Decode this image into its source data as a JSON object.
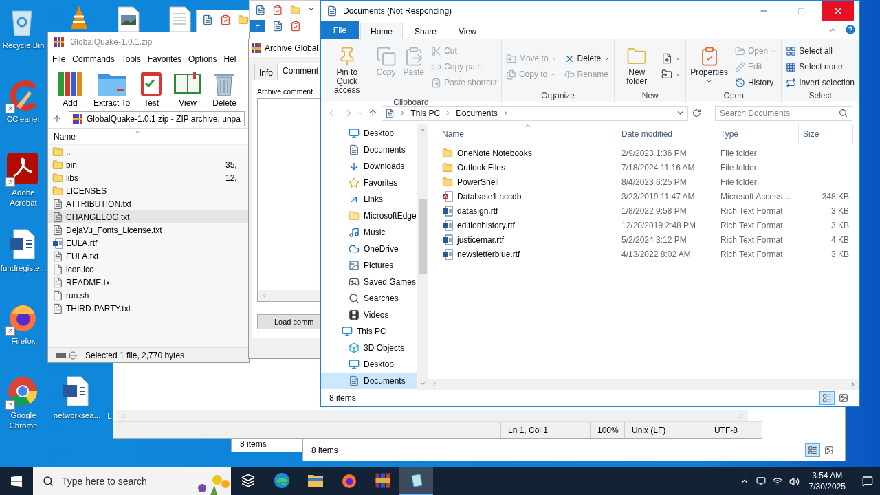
{
  "desktop_icons": [
    {
      "label": "Recycle Bin",
      "shortcut": false
    },
    {
      "label": "CCleaner",
      "shortcut": true
    },
    {
      "label": "Adobe Acrobat",
      "shortcut": true
    },
    {
      "label": "fundregiste...",
      "shortcut": false
    },
    {
      "label": "Firefox",
      "shortcut": true
    },
    {
      "label": "Google Chrome",
      "shortcut": true
    },
    {
      "label": "networksea...",
      "shortcut": false
    },
    {
      "label": "L"
    }
  ],
  "hidden_window_tab": "F",
  "editor_window": {
    "status": [
      "Ln 1, Col 1",
      "100%",
      "Unix (LF)",
      "UTF-8"
    ]
  },
  "back_windows": [
    {
      "status": "8 items"
    },
    {
      "status": "8 items"
    }
  ],
  "winrar": {
    "title": "GlobalQuake-1.0.1.zip",
    "menu": [
      "File",
      "Commands",
      "Tools",
      "Favorites",
      "Options",
      "Hel"
    ],
    "toolbar": [
      "Add",
      "Extract To",
      "Test",
      "View",
      "Delete"
    ],
    "address": "GlobalQuake-1.0.1.zip - ZIP archive, unpa",
    "column": "Name",
    "rows": [
      {
        "name": "..",
        "size": "",
        "kind": "folder",
        "selected": false
      },
      {
        "name": "bin",
        "size": "35,",
        "kind": "folder",
        "selected": false
      },
      {
        "name": "libs",
        "size": "12,",
        "kind": "folder",
        "selected": false
      },
      {
        "name": "LICENSES",
        "size": "",
        "kind": "folder",
        "selected": false
      },
      {
        "name": "ATTRIBUTION.txt",
        "size": "",
        "kind": "text",
        "selected": false
      },
      {
        "name": "CHANGELOG.txt",
        "size": "",
        "kind": "text",
        "selected": true
      },
      {
        "name": "DejaVu_Fonts_License.txt",
        "size": "",
        "kind": "text",
        "selected": false
      },
      {
        "name": "EULA.rtf",
        "size": "",
        "kind": "word",
        "selected": false
      },
      {
        "name": "EULA.txt",
        "size": "",
        "kind": "text",
        "selected": false
      },
      {
        "name": "icon.ico",
        "size": "",
        "kind": "blank",
        "selected": false
      },
      {
        "name": "README.txt",
        "size": "",
        "kind": "text",
        "selected": false
      },
      {
        "name": "run.sh",
        "size": "",
        "kind": "blank",
        "selected": false
      },
      {
        "name": "THIRD-PARTY.txt",
        "size": "",
        "kind": "text",
        "selected": false
      }
    ],
    "status": "Selected 1 file, 2,770 bytes"
  },
  "comment_dialog": {
    "title": "Archive Global",
    "tabs": [
      {
        "label": "Info",
        "selected": false
      },
      {
        "label": "Comment",
        "selected": true
      }
    ],
    "label": "Archive comment",
    "button": "Load comm"
  },
  "explorer": {
    "title": "Documents (Not Responding)",
    "file_tab": "File",
    "ribbon_tabs": [
      {
        "label": "Home",
        "selected": true
      },
      {
        "label": "Share",
        "selected": false
      },
      {
        "label": "View",
        "selected": false
      }
    ],
    "ribbon_groups": [
      {
        "label": "Clipboard",
        "columns": [
          [
            {
              "label": "Pin to Quick access",
              "kind": "large",
              "disabled": false
            }
          ],
          [
            {
              "label": "Copy",
              "kind": "large",
              "disabled": true
            }
          ],
          [
            {
              "label": "Paste",
              "kind": "large",
              "disabled": true
            }
          ],
          [
            {
              "label": "Cut",
              "kind": "small",
              "disabled": true
            },
            {
              "label": "Copy path",
              "kind": "small",
              "disabled": true
            },
            {
              "label": "Paste shortcut",
              "kind": "small",
              "disabled": true
            }
          ]
        ]
      },
      {
        "label": "Organize",
        "columns": [
          [
            {
              "label": "Move to",
              "kind": "small",
              "disabled": true,
              "dropdown": true
            },
            {
              "label": "Copy to",
              "kind": "small",
              "disabled": true,
              "dropdown": true
            }
          ],
          [
            {
              "label": "Delete",
              "kind": "small",
              "disabled": false,
              "dropdown": true
            },
            {
              "label": "Rename",
              "kind": "small",
              "disabled": true
            }
          ]
        ]
      },
      {
        "label": "New",
        "columns": [
          [
            {
              "label": "New folder",
              "kind": "large",
              "disabled": false
            }
          ],
          [
            {
              "kind": "icon",
              "disabled": false,
              "dropdown": true
            },
            {
              "kind": "icon",
              "disabled": false,
              "dropdown": true
            }
          ]
        ]
      },
      {
        "label": "Open",
        "columns": [
          [
            {
              "label": "Properties",
              "kind": "large",
              "disabled": false,
              "dropdown": true
            }
          ],
          [
            {
              "label": "Open",
              "kind": "small",
              "disabled": true,
              "dropdown": true
            },
            {
              "label": "Edit",
              "kind": "small",
              "disabled": true
            },
            {
              "label": "History",
              "kind": "small",
              "disabled": false
            }
          ]
        ]
      },
      {
        "label": "Select",
        "columns": [
          [
            {
              "label": "Select all",
              "kind": "small",
              "disabled": false
            },
            {
              "label": "Select none",
              "kind": "small",
              "disabled": false
            },
            {
              "label": "Invert selection",
              "kind": "small",
              "disabled": false
            }
          ]
        ]
      }
    ],
    "breadcrumb": [
      "This PC",
      "Documents"
    ],
    "search": {
      "placeholder": "Search Documents"
    },
    "nav": [
      {
        "label": "Desktop",
        "selected": false
      },
      {
        "label": "Documents",
        "selected": false
      },
      {
        "label": "Downloads",
        "selected": false
      },
      {
        "label": "Favorites",
        "selected": false
      },
      {
        "label": "Links",
        "selected": false
      },
      {
        "label": "MicrosoftEdge",
        "selected": false
      },
      {
        "label": "Music",
        "selected": false
      },
      {
        "label": "OneDrive",
        "selected": false
      },
      {
        "label": "Pictures",
        "selected": false
      },
      {
        "label": "Saved Games",
        "selected": false
      },
      {
        "label": "Searches",
        "selected": false
      },
      {
        "label": "Videos",
        "selected": false
      },
      {
        "label": "This PC",
        "selected": false,
        "children": [
          {
            "label": "3D Objects",
            "selected": false
          },
          {
            "label": "Desktop",
            "selected": false
          },
          {
            "label": "Documents",
            "selected": true
          }
        ]
      }
    ],
    "columns": [
      "Name",
      "Date modified",
      "Type",
      "Size"
    ],
    "rows": [
      {
        "name": "OneNote Notebooks",
        "date": "2/9/2023 1:36 PM",
        "type": "File folder",
        "size": "",
        "kind": "folder"
      },
      {
        "name": "Outlook Files",
        "date": "7/18/2024 11:16 AM",
        "type": "File folder",
        "size": "",
        "kind": "folder"
      },
      {
        "name": "PowerShell",
        "date": "8/4/2023 6:25 PM",
        "type": "File folder",
        "size": "",
        "kind": "folder"
      },
      {
        "name": "Database1.accdb",
        "date": "3/23/2019 11:47 AM",
        "type": "Microsoft Access ...",
        "size": "348 KB",
        "kind": "access"
      },
      {
        "name": "datasign.rtf",
        "date": "1/8/2022 9:58 PM",
        "type": "Rich Text Format",
        "size": "3 KB",
        "kind": "word"
      },
      {
        "name": "editionhistory.rtf",
        "date": "12/20/2019 2:48 PM",
        "type": "Rich Text Format",
        "size": "3 KB",
        "kind": "word"
      },
      {
        "name": "justicemar.rtf",
        "date": "5/2/2024 3:12 PM",
        "type": "Rich Text Format",
        "size": "4 KB",
        "kind": "word"
      },
      {
        "name": "newsletterblue.rtf",
        "date": "4/13/2022 8:02 AM",
        "type": "Rich Text Format",
        "size": "3 KB",
        "kind": "word"
      }
    ],
    "status": "8 items"
  },
  "taskbar": {
    "search": {
      "placeholder": "Type here to search"
    },
    "apps": [
      {
        "active": false
      },
      {
        "active": false
      },
      {
        "active": false
      },
      {
        "active": false
      },
      {
        "active": false
      },
      {
        "active": true
      }
    ],
    "time": "3:54 AM",
    "date": "7/30/2025"
  }
}
